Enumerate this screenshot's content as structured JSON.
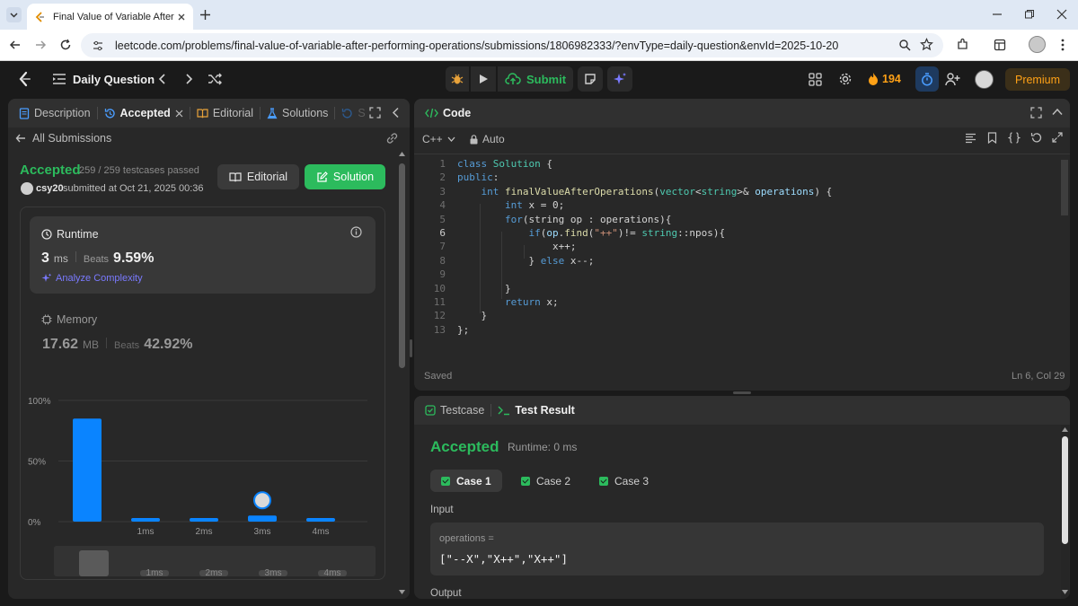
{
  "browser": {
    "tab_title": "Final Value of Variable After Per",
    "url": "leetcode.com/problems/final-value-of-variable-after-performing-operations/submissions/1806982333/?envType=daily-question&envId=2025-10-20"
  },
  "nav": {
    "title": "Daily Question",
    "submit_label": "Submit",
    "streak_count": "194",
    "premium_label": "Premium"
  },
  "left_panel": {
    "tabs": [
      {
        "label": "Description"
      },
      {
        "label": "Accepted"
      },
      {
        "label": "Editorial"
      },
      {
        "label": "Solutions"
      },
      {
        "label": "S"
      }
    ],
    "back_label": "All Submissions",
    "status": "Accepted",
    "testcases": "259 / 259 testcases passed",
    "user": "csy20",
    "submitted_text": "submitted at Oct 21, 2025 00:36",
    "editorial_button": "Editorial",
    "solution_button": "Solution",
    "runtime": {
      "label": "Runtime",
      "value": "3",
      "unit": "ms",
      "beats_label": "Beats",
      "beats_value": "9.59%",
      "analyze_label": "Analyze Complexity"
    },
    "memory": {
      "label": "Memory",
      "value": "17.62",
      "unit": "MB",
      "beats_label": "Beats",
      "beats_value": "42.92%"
    }
  },
  "chart_data": {
    "type": "bar",
    "categories": [
      "",
      "1ms",
      "2ms",
      "3ms",
      "4ms"
    ],
    "values": [
      85,
      3,
      3,
      5,
      3
    ],
    "y_ticks": [
      "100%",
      "50%",
      "0%"
    ],
    "ylim": [
      0,
      100
    ],
    "highlight_index": 3,
    "bar_color": "#0a84ff",
    "mini_categories": [
      "1ms",
      "2ms",
      "3ms",
      "4ms"
    ]
  },
  "code_panel": {
    "title": "Code",
    "language": "C++",
    "mode": "Auto",
    "saved_label": "Saved",
    "cursor_pos": "Ln 6, Col 29",
    "lines": [
      "1",
      "2",
      "3",
      "4",
      "5",
      "6",
      "7",
      "8",
      "9",
      "10",
      "11",
      "12",
      "13"
    ]
  },
  "result_panel": {
    "testcase_tab": "Testcase",
    "result_tab": "Test Result",
    "status": "Accepted",
    "runtime": "Runtime: 0 ms",
    "cases": [
      "Case 1",
      "Case 2",
      "Case 3"
    ],
    "input_label": "Input",
    "var_name": "operations =",
    "var_value": "[\"--X\",\"X++\",\"X++\"]",
    "output_label": "Output"
  },
  "colors": {
    "accent_green": "#2cbb5d",
    "accent_blue": "#0a84ff",
    "streak_orange": "#ffa116"
  }
}
